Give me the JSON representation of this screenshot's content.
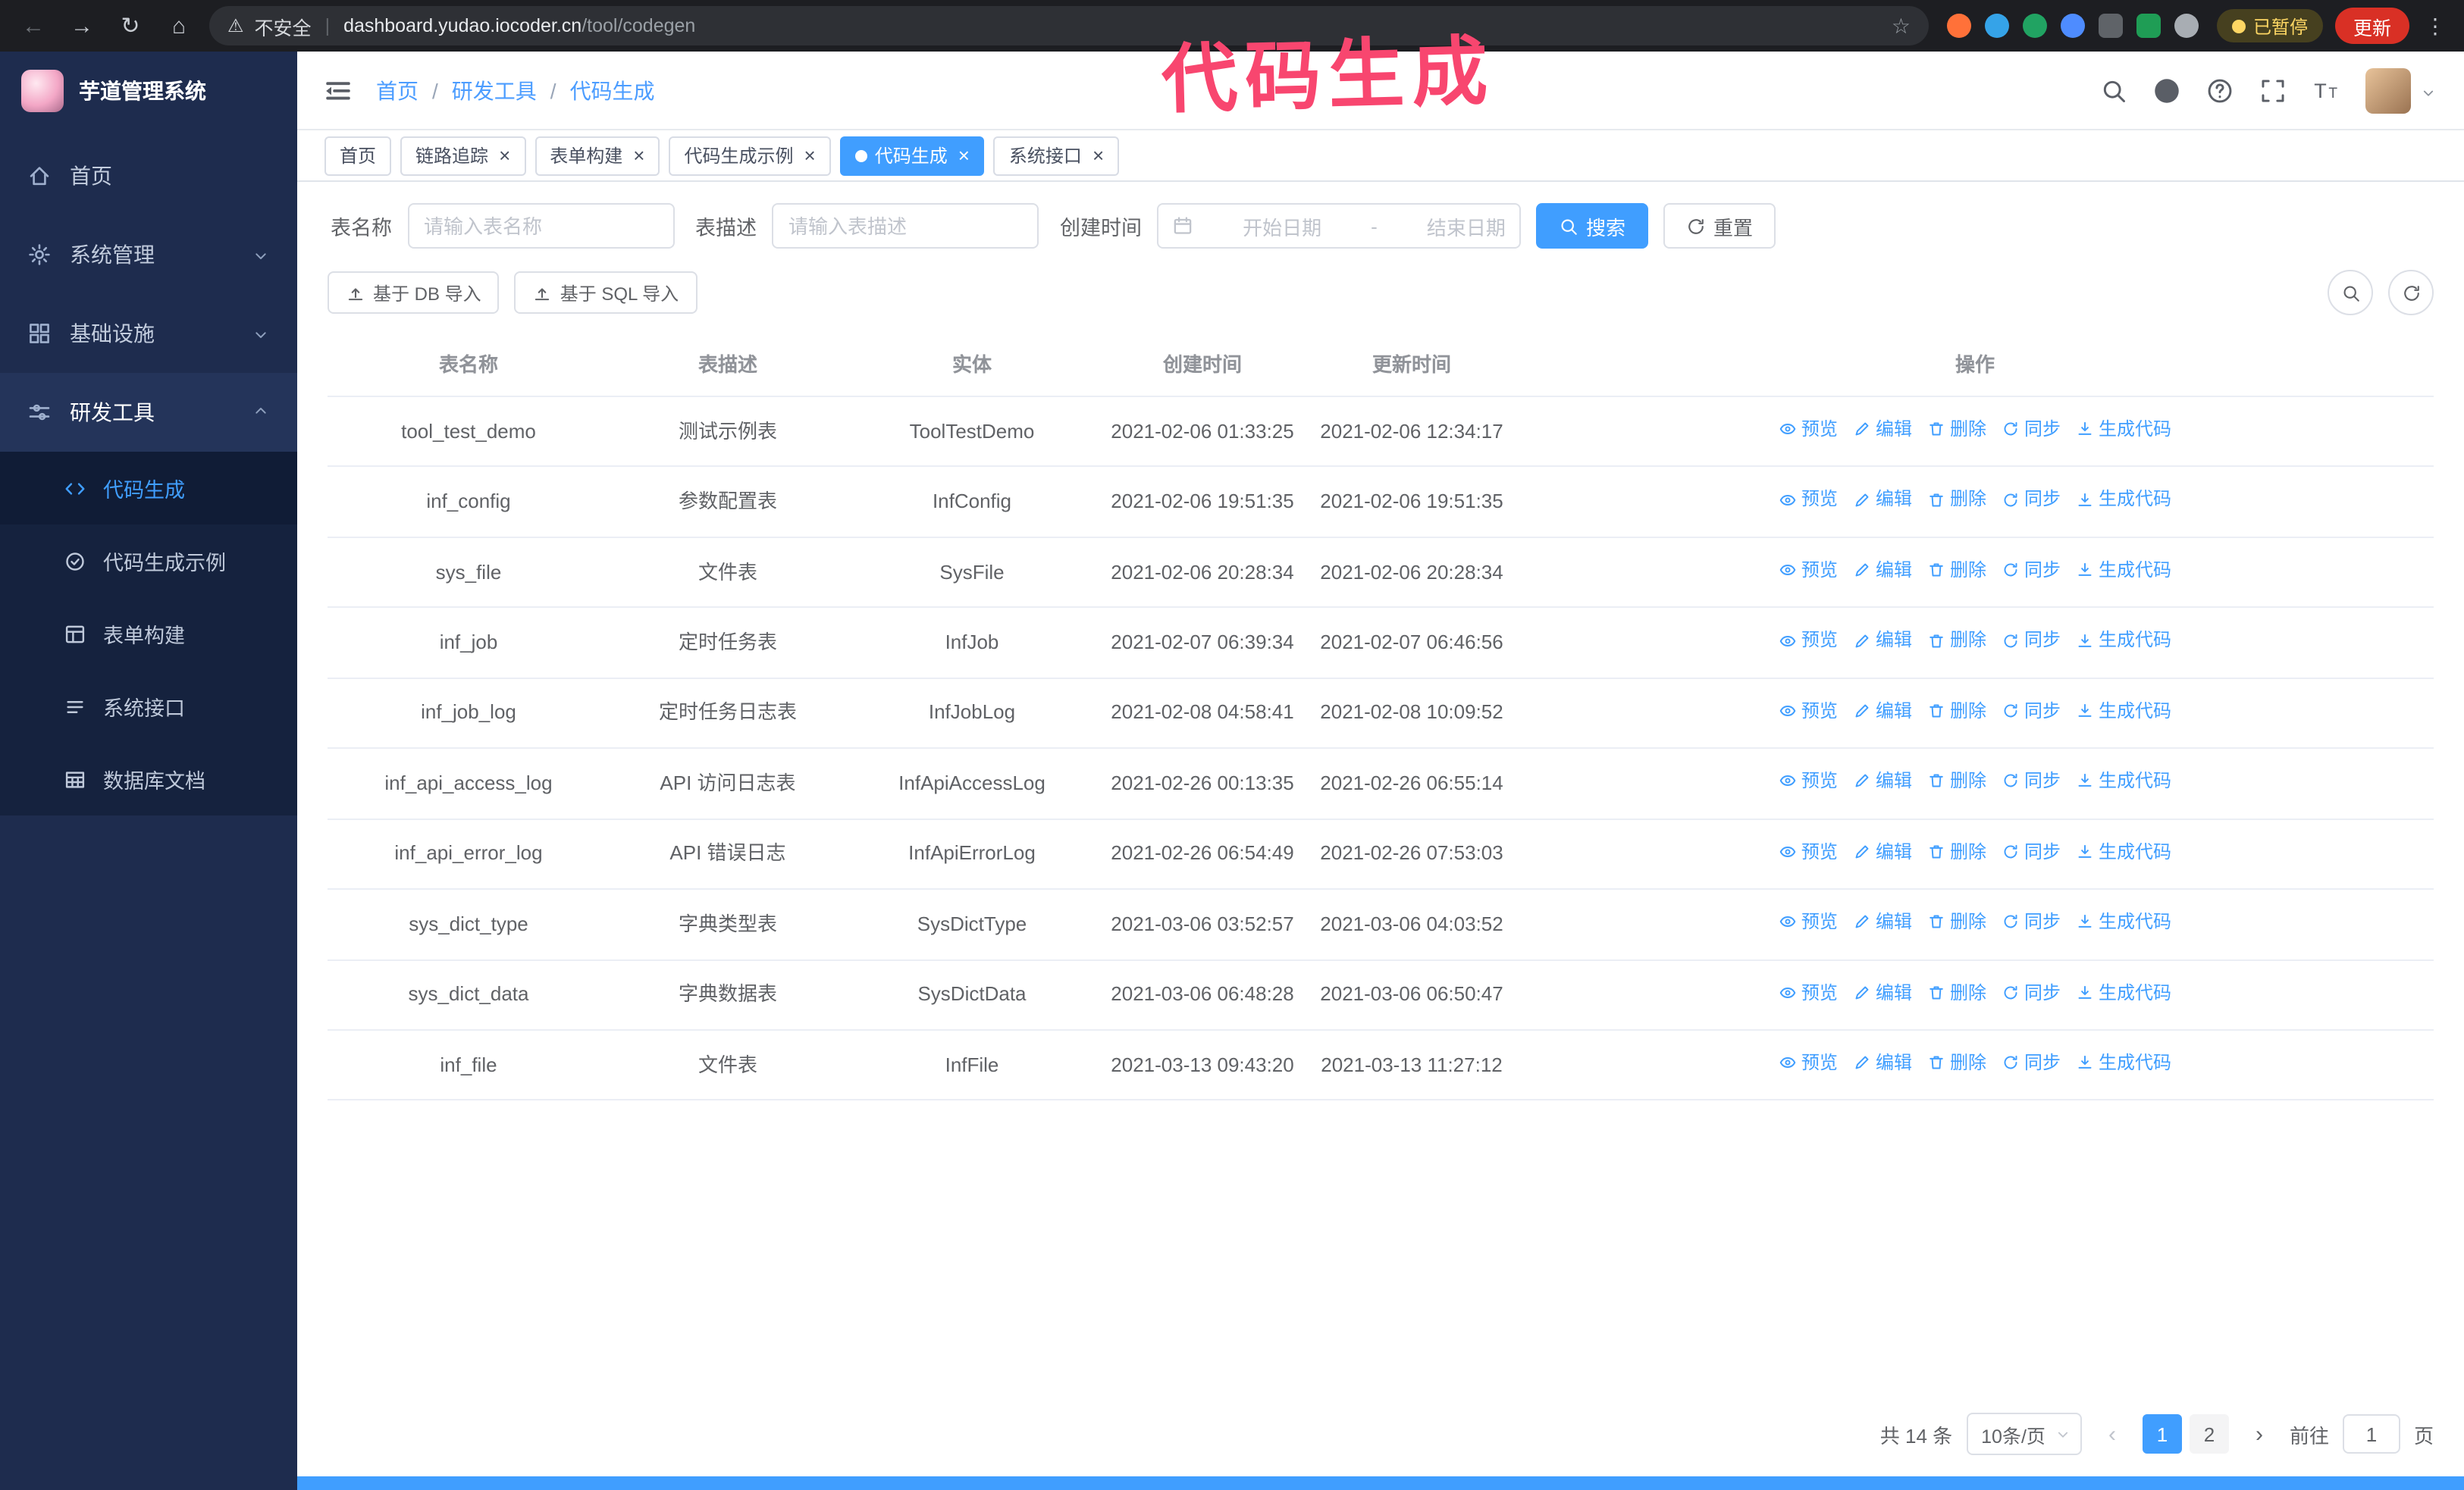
{
  "annotation": {
    "text": "代码生成"
  },
  "colors": {
    "accent_blue": "#409eff",
    "annotation_pink": "#f8466f",
    "sidebar_bg": "#1e2c4e",
    "chrome_bg": "#1d1e22",
    "update_red": "#d93025",
    "paused_yellow": "#fdd663"
  },
  "browser": {
    "security_text": "不安全",
    "url_host": "dashboard.yudao.iocoder.cn",
    "url_path": "/tool/codegen",
    "paused_badge": "已暂停",
    "update_button": "更新"
  },
  "sidebar": {
    "title": "芋道管理系统",
    "menu": [
      {
        "label": "首页",
        "icon": "home",
        "expandable": false,
        "open": false
      },
      {
        "label": "系统管理",
        "icon": "gear",
        "expandable": true,
        "open": false
      },
      {
        "label": "基础设施",
        "icon": "infra",
        "expandable": true,
        "open": false
      },
      {
        "label": "研发工具",
        "icon": "tools",
        "expandable": true,
        "open": true,
        "children": [
          {
            "label": "代码生成",
            "icon": "code",
            "active": true
          },
          {
            "label": "代码生成示例",
            "icon": "badge",
            "active": false
          },
          {
            "label": "表单构建",
            "icon": "form",
            "active": false
          },
          {
            "label": "系统接口",
            "icon": "api",
            "active": false
          },
          {
            "label": "数据库文档",
            "icon": "db",
            "active": false
          }
        ]
      }
    ]
  },
  "header": {
    "breadcrumb": [
      "首页",
      "研发工具",
      "代码生成"
    ]
  },
  "tabs": [
    {
      "label": "首页",
      "closable": false,
      "active": false
    },
    {
      "label": "链路追踪",
      "closable": true,
      "active": false
    },
    {
      "label": "表单构建",
      "closable": true,
      "active": false
    },
    {
      "label": "代码生成示例",
      "closable": true,
      "active": false
    },
    {
      "label": "代码生成",
      "closable": true,
      "active": true
    },
    {
      "label": "系统接口",
      "closable": true,
      "active": false
    }
  ],
  "filters": {
    "name_label": "表名称",
    "name_placeholder": "请输入表名称",
    "desc_label": "表描述",
    "desc_placeholder": "请输入表描述",
    "time_label": "创建时间",
    "start_placeholder": "开始日期",
    "separator": "-",
    "end_placeholder": "结束日期",
    "search": "搜索",
    "reset": "重置"
  },
  "toolbar": {
    "import_db": "基于 DB 导入",
    "import_sql": "基于 SQL 导入"
  },
  "table": {
    "columns": [
      "表名称",
      "表描述",
      "实体",
      "创建时间",
      "更新时间",
      "操作"
    ],
    "actions": [
      {
        "label": "预览",
        "icon": "eye"
      },
      {
        "label": "编辑",
        "icon": "edit"
      },
      {
        "label": "删除",
        "icon": "trash"
      },
      {
        "label": "同步",
        "icon": "sync"
      },
      {
        "label": "生成代码",
        "icon": "download"
      }
    ],
    "rows": [
      {
        "name": "tool_test_demo",
        "desc": "测试示例表",
        "entity": "ToolTestDemo",
        "created": "2021-02-06 01:33:25",
        "updated": "2021-02-06 12:34:17"
      },
      {
        "name": "inf_config",
        "desc": "参数配置表",
        "entity": "InfConfig",
        "created": "2021-02-06 19:51:35",
        "updated": "2021-02-06 19:51:35"
      },
      {
        "name": "sys_file",
        "desc": "文件表",
        "entity": "SysFile",
        "created": "2021-02-06 20:28:34",
        "updated": "2021-02-06 20:28:34"
      },
      {
        "name": "inf_job",
        "desc": "定时任务表",
        "entity": "InfJob",
        "created": "2021-02-07 06:39:34",
        "updated": "2021-02-07 06:46:56"
      },
      {
        "name": "inf_job_log",
        "desc": "定时任务日志表",
        "entity": "InfJobLog",
        "created": "2021-02-08 04:58:41",
        "updated": "2021-02-08 10:09:52"
      },
      {
        "name": "inf_api_access_log",
        "desc": "API 访问日志表",
        "entity": "InfApiAccessLog",
        "created": "2021-02-26 00:13:35",
        "updated": "2021-02-26 06:55:14"
      },
      {
        "name": "inf_api_error_log",
        "desc": "API 错误日志",
        "entity": "InfApiErrorLog",
        "created": "2021-02-26 06:54:49",
        "updated": "2021-02-26 07:53:03"
      },
      {
        "name": "sys_dict_type",
        "desc": "字典类型表",
        "entity": "SysDictType",
        "created": "2021-03-06 03:52:57",
        "updated": "2021-03-06 04:03:52"
      },
      {
        "name": "sys_dict_data",
        "desc": "字典数据表",
        "entity": "SysDictData",
        "created": "2021-03-06 06:48:28",
        "updated": "2021-03-06 06:50:47"
      },
      {
        "name": "inf_file",
        "desc": "文件表",
        "entity": "InfFile",
        "created": "2021-03-13 09:43:20",
        "updated": "2021-03-13 11:27:12"
      }
    ]
  },
  "pagination": {
    "total": "共 14 条",
    "page_size": "10条/页",
    "pages": [
      "1",
      "2"
    ],
    "active_page": "1",
    "goto_prefix": "前往",
    "goto_value": "1",
    "goto_suffix": "页"
  }
}
